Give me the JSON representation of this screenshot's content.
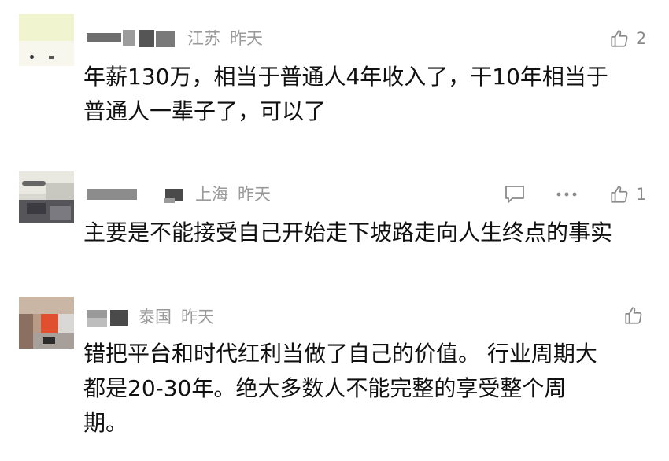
{
  "comments": [
    {
      "location": "江苏",
      "time": "昨天",
      "likes": "2",
      "text": "年薪130万，相当于普通人4年收入了，干10年相当于\n普通人一辈子了，可以了"
    },
    {
      "location": "上海",
      "time": "昨天",
      "likes": "1",
      "text": "主要是不能接受自己开始走下坡路走向人生终点的事实"
    },
    {
      "location": "泰国",
      "time": "昨天",
      "likes": "",
      "text": "错把平台和时代红利当做了自己的价值。 行业周期大\n都是20-30年。绝大多数人不能完整的享受整个周\n期。"
    }
  ],
  "icons": {
    "like": "thumbs-up-icon",
    "reply": "comment-bubble-icon",
    "more": "more-dots-icon"
  },
  "colors": {
    "meta_text": "#9a9a9a",
    "body_text": "#111111",
    "icon": "#8a8a8a"
  }
}
